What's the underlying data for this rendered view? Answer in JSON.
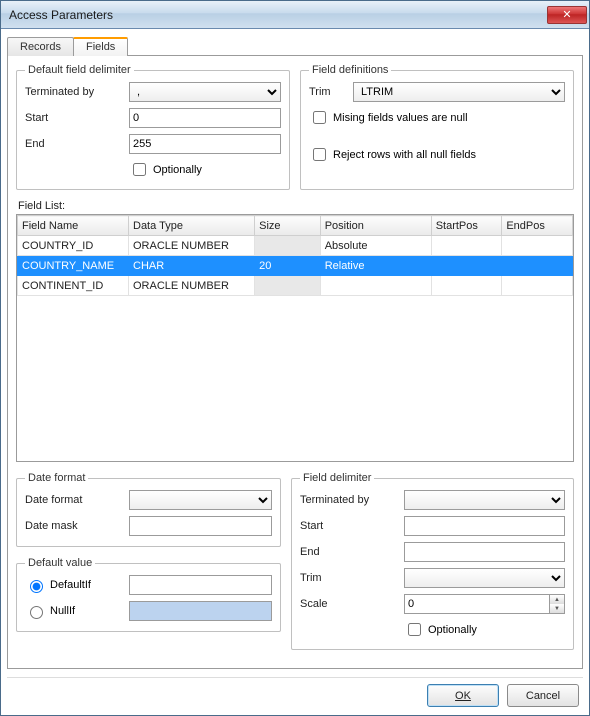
{
  "window": {
    "title": "Access Parameters"
  },
  "tabs": [
    {
      "id": "records",
      "label": "Records",
      "active": false
    },
    {
      "id": "fields",
      "label": "Fields",
      "active": true
    }
  ],
  "default_delim": {
    "legend": "Default field delimiter",
    "terminated_label": "Terminated by",
    "terminated_value": ",",
    "start_label": "Start",
    "start_value": "0",
    "end_label": "End",
    "end_value": "255",
    "optionally_label": "Optionally",
    "optionally_checked": false
  },
  "field_defs": {
    "legend": "Field definitions",
    "trim_label": "Trim",
    "trim_value": "LTRIM",
    "missing_label": "Mising fields values are null",
    "missing_checked": false,
    "reject_label": "Reject rows with all null fields",
    "reject_checked": false
  },
  "field_list": {
    "label": "Field List:",
    "columns": [
      "Field Name",
      "Data Type",
      "Size",
      "Position",
      "StartPos",
      "EndPos"
    ],
    "col_widths": [
      "110",
      "125",
      "65",
      "110",
      "70",
      "70"
    ],
    "rows": [
      {
        "cells": [
          "COUNTRY_ID",
          "ORACLE NUMBER",
          "",
          "Absolute",
          "",
          ""
        ],
        "size_grey": true,
        "selected": false
      },
      {
        "cells": [
          "COUNTRY_NAME",
          "CHAR",
          "20",
          "Relative",
          "",
          ""
        ],
        "size_grey": false,
        "selected": true
      },
      {
        "cells": [
          "CONTINENT_ID",
          "ORACLE NUMBER",
          "",
          "",
          "",
          ""
        ],
        "size_grey": true,
        "selected": false
      }
    ]
  },
  "date_format": {
    "legend": "Date format",
    "format_label": "Date format",
    "format_value": "",
    "mask_label": "Date mask",
    "mask_value": ""
  },
  "default_value": {
    "legend": "Default value",
    "defaultif_label": "DefaultIf",
    "defaultif_value": "",
    "nullif_label": "NullIf",
    "nullif_value": "",
    "selected": "defaultif"
  },
  "field_delim": {
    "legend": "Field delimiter",
    "terminated_label": "Terminated by",
    "terminated_value": "",
    "start_label": "Start",
    "start_value": "",
    "end_label": "End",
    "end_value": "",
    "trim_label": "Trim",
    "trim_value": "",
    "scale_label": "Scale",
    "scale_value": "0",
    "optionally_label": "Optionally",
    "optionally_checked": false
  },
  "buttons": {
    "ok": "OK",
    "cancel": "Cancel"
  }
}
